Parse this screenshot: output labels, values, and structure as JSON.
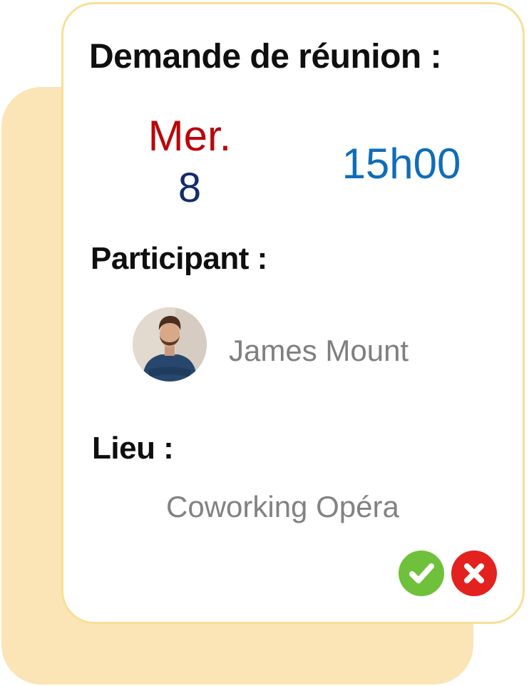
{
  "meeting": {
    "title": "Demande de réunion :",
    "day_name": "Mer.",
    "day_number": "8",
    "time": "15h00"
  },
  "participant": {
    "label": "Participant :",
    "name": "James Mount",
    "avatar_icon": "person-photo-avatar"
  },
  "location": {
    "label": "Lieu :",
    "value": "Coworking Opéra"
  },
  "actions": {
    "accept_icon": "check-icon",
    "decline_icon": "close-icon"
  },
  "colors": {
    "back_card": "#fbe4b5",
    "card_border": "#f8df95",
    "day_name": "#b8070a",
    "day_number": "#142b6b",
    "time": "#0f6db8",
    "accept": "#6fc03a",
    "decline": "#e3211f"
  }
}
